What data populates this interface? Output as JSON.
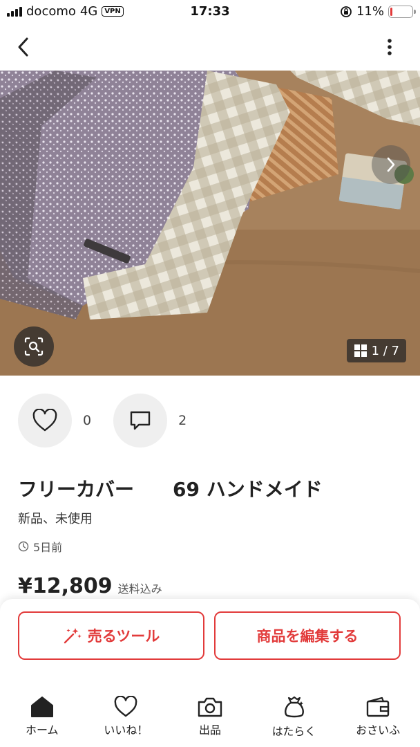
{
  "status_bar": {
    "carrier": "docomo",
    "network": "4G",
    "vpn": "VPN",
    "time": "17:33",
    "battery": "11%",
    "battery_level": 0.11
  },
  "nav": {
    "back_icon": "chevron-left-icon",
    "more_icon": "more-vertical-icon"
  },
  "gallery": {
    "counter": "1 / 7",
    "next_icon": "chevron-right-icon",
    "lens_icon": "image-search-icon",
    "grid_icon": "grid-icon"
  },
  "actions": {
    "like_count": "0",
    "comment_count": "2"
  },
  "item": {
    "title": "フリーカバー　　69 ハンドメイド",
    "condition": "新品、未使用",
    "posted": "5日前",
    "price": "¥12,809",
    "shipping": "送料込み"
  },
  "buttons": {
    "sell_tool": "売るツール",
    "edit_item": "商品を編集する"
  },
  "tabs": [
    {
      "label": "ホーム",
      "icon": "home-icon"
    },
    {
      "label": "いいね！",
      "icon": "heart-icon"
    },
    {
      "label": "出品",
      "icon": "camera-icon"
    },
    {
      "label": "はたらく",
      "icon": "money-bag-icon"
    },
    {
      "label": "おさいふ",
      "icon": "wallet-icon"
    }
  ],
  "colors": {
    "accent": "#e23b3b",
    "text": "#222222"
  }
}
